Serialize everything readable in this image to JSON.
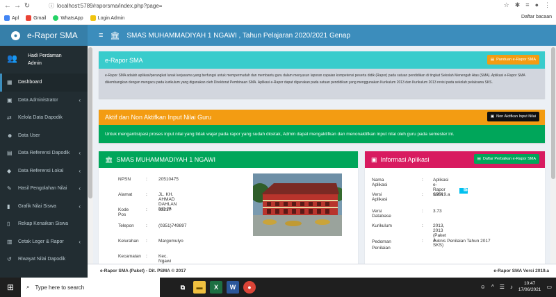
{
  "browser": {
    "url": "localhost:5789/raporsma/index.php?page=",
    "bookmarks": [
      "Apl",
      "Gmail",
      "WhatsApp",
      "Login Admin"
    ],
    "reading_list": "Daftar bacaan",
    "back": "←",
    "forward": "→",
    "reload": "↻"
  },
  "brand": {
    "title": "e-Rapor SMA",
    "accent": "#3c8dbc",
    "sidebar_bg": "#222d32"
  },
  "user": {
    "line1": "Hadi Perdaman",
    "line2": "Admin"
  },
  "sidebar": {
    "items": [
      {
        "label": "Dashboard",
        "icon": "dashboard-icon",
        "active": true
      },
      {
        "label": "Data Administrator",
        "icon": "briefcase-icon"
      },
      {
        "label": "Kelola Data Dapodik",
        "icon": "sync-icon"
      },
      {
        "label": "Data User",
        "icon": "users-icon"
      },
      {
        "label": "Data Referensi Dapodik",
        "icon": "table-icon"
      },
      {
        "label": "Data Referensi Lokal",
        "icon": "tag-icon"
      },
      {
        "label": "Hasil Pengolahan Nilai",
        "icon": "pencil-icon"
      },
      {
        "label": "Grafik Nilai Siswa",
        "icon": "bar-chart-icon"
      },
      {
        "label": "Rekap Kenaikan Siswa",
        "icon": "file-icon"
      },
      {
        "label": "Cetak Leger & Rapor",
        "icon": "print-icon"
      },
      {
        "label": "Riwayat Nilai Dapodik",
        "icon": "history-icon"
      }
    ]
  },
  "header": {
    "title": "SMAS MUHAMMADIYAH 1 NGAWI , Tahun Pelajaran 2020/2021 Genap"
  },
  "box_info": {
    "title": "e-Rapor SMA",
    "button": "Panduan e-Rapor SMA",
    "text": "e-Rapor SMA adalah aplikasi/perangkat lunak kerjasama yang berfungsi untuk mempermudah dan membantu guru dalam menyusun laporan capaian kompetensi peserta didik (Rapor) pada satuan pendidikan di tingkat Sekolah Menengah Atas (SMA). Aplikasi e-Rapor SMA dikembangkan dengan mengacu pada kurikulum yang digunakan oleh Direktorat Pembinaan SMA. Aplikasi e-Rapor dapat digunakan pada satuan pendidikan yang menggunakan Kurikulum 2013 dan Kurikulum 2013 revisi pada sekolah pelaksana SKS.",
    "color": "#39cccc"
  },
  "box_aktif": {
    "title": "Aktif dan Non Aktifkan Input Nilai Guru",
    "button": "Non Aktifkan Input Nilai",
    "text": "Untuk mengantisipasi proses input nilai yang tidak wajar pada rapor yang sudah dicetak, Admin dapat mengaktifkan dan menonaktifkan input nilai oleh guru pada semester ini.",
    "head_color": "#f39c12",
    "body_color": "#00a65a"
  },
  "box_school": {
    "title": "SMAS MUHAMMADIYAH 1 NGAWI",
    "color": "#00a65a",
    "rows": [
      {
        "k": "NPSN",
        "v": "20510475"
      },
      {
        "k": "Alamat",
        "v": "JL. KH. AHMAD DAHLAN NO 26"
      },
      {
        "k": "Kode Pos",
        "v": "63217"
      },
      {
        "k": "Telepon",
        "v": "(0351)749897"
      },
      {
        "k": "Kelurahan",
        "v": "Margomulyo"
      },
      {
        "k": "Kecamatan",
        "v": "Kec. Ngawi"
      }
    ]
  },
  "box_app": {
    "title": "Informasi Aplikasi",
    "button": "Daftar Perbaikan e-Rapor SMA",
    "color": "#d81b60",
    "rows": [
      {
        "k": "Nama Aplikasi",
        "v": "Aplikasi e-Rapor SMA"
      },
      {
        "k": "Versi Aplikasi",
        "v": "v.2019.a",
        "btn": "Daftar Perubahan"
      },
      {
        "k": "Versi Database",
        "v": "3.73"
      },
      {
        "k": "Kurikulum",
        "v": "2013, 2013 (Paket A SKS)"
      },
      {
        "k": "Pedoman Penilaian",
        "v": "Juknis Penilaian Tahun 2017"
      }
    ]
  },
  "footer": {
    "left": "e-Rapor SMA (Paket) - Dit. PSMA © 2017",
    "right": "e-Rapor SMA Versi 2019.a"
  },
  "taskbar": {
    "search": "Type here to search",
    "time": "10:47",
    "date": "17/06/2021"
  }
}
